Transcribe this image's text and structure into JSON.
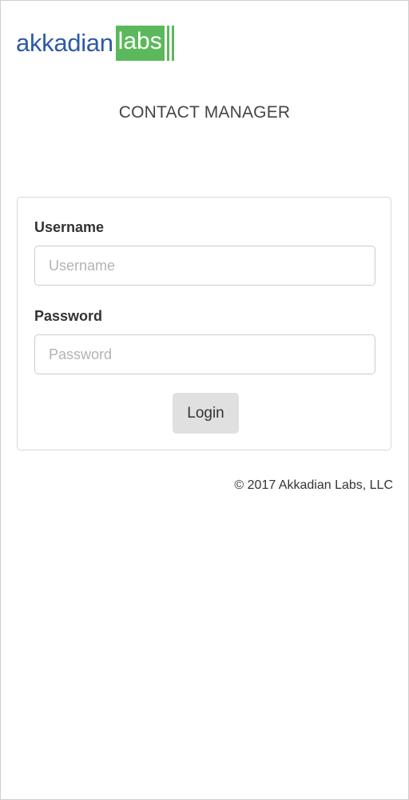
{
  "logo": {
    "primary_text": "akkadian",
    "secondary_text": "labs",
    "colors": {
      "primary": "#2e5aa8",
      "accent": "#5cb85c"
    }
  },
  "app_title": "CONTACT MANAGER",
  "login_form": {
    "username_label": "Username",
    "username_placeholder": "Username",
    "username_value": "",
    "password_label": "Password",
    "password_placeholder": "Password",
    "password_value": "",
    "login_button_label": "Login"
  },
  "footer": {
    "copyright": "© 2017 Akkadian Labs, LLC"
  }
}
